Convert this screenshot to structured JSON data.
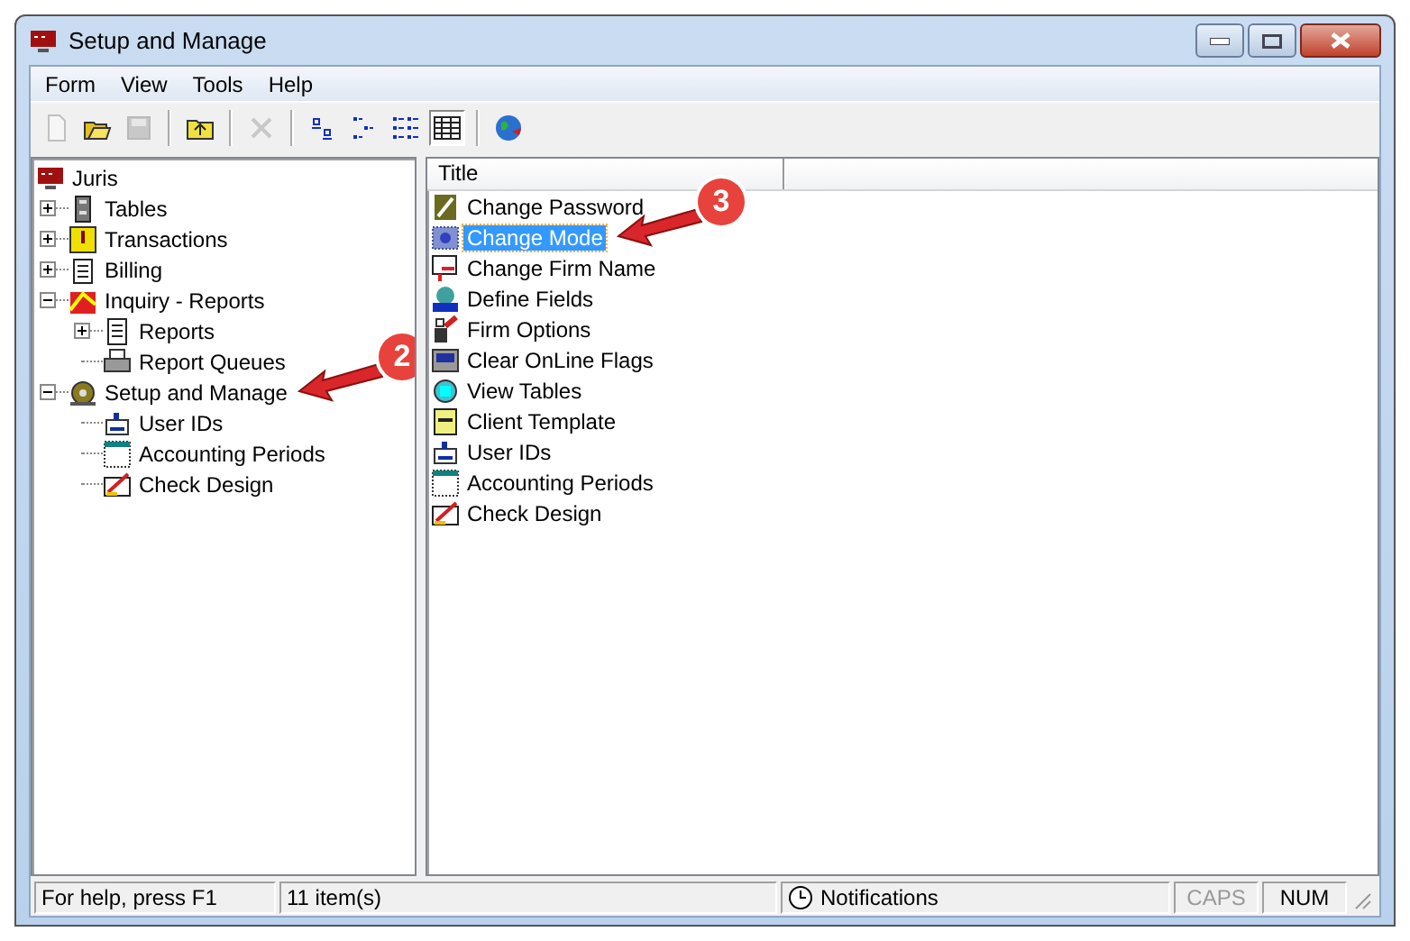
{
  "window": {
    "title": "Setup and Manage"
  },
  "menu": [
    "Form",
    "View",
    "Tools",
    "Help"
  ],
  "toolbar": [
    {
      "kind": "new",
      "disabled": true
    },
    {
      "kind": "open",
      "disabled": false
    },
    {
      "kind": "save",
      "disabled": true
    },
    {
      "kind": "sep"
    },
    {
      "kind": "up",
      "disabled": false
    },
    {
      "kind": "sep"
    },
    {
      "kind": "delete",
      "disabled": true
    },
    {
      "kind": "sep"
    },
    {
      "kind": "large",
      "disabled": false,
      "pressed": false
    },
    {
      "kind": "small",
      "disabled": false,
      "pressed": false
    },
    {
      "kind": "list",
      "disabled": false,
      "pressed": false
    },
    {
      "kind": "details",
      "disabled": false,
      "pressed": true
    },
    {
      "kind": "sep"
    },
    {
      "kind": "globe",
      "disabled": false
    }
  ],
  "tree": {
    "label": "Juris",
    "children": [
      {
        "label": "Tables",
        "expanded": false
      },
      {
        "label": "Transactions",
        "expanded": false
      },
      {
        "label": "Billing",
        "expanded": false
      },
      {
        "label": "Inquiry - Reports",
        "expanded": true,
        "children": [
          {
            "label": "Reports",
            "expanded": false
          },
          {
            "label": "Report Queues"
          }
        ]
      },
      {
        "label": "Setup and Manage",
        "expanded": true,
        "children": [
          {
            "label": "User IDs"
          },
          {
            "label": "Accounting Periods"
          },
          {
            "label": "Check Design"
          }
        ]
      }
    ]
  },
  "list": {
    "columns": [
      "Title"
    ],
    "rows": [
      {
        "title": "Change Password",
        "selected": false
      },
      {
        "title": "Change Mode",
        "selected": true
      },
      {
        "title": "Change Firm Name",
        "selected": false
      },
      {
        "title": "Define Fields",
        "selected": false
      },
      {
        "title": "Firm Options",
        "selected": false
      },
      {
        "title": "Clear OnLine Flags",
        "selected": false
      },
      {
        "title": "View Tables",
        "selected": false
      },
      {
        "title": "Client Template",
        "selected": false
      },
      {
        "title": "User IDs",
        "selected": false
      },
      {
        "title": "Accounting Periods",
        "selected": false
      },
      {
        "title": "Check Design",
        "selected": false
      }
    ]
  },
  "callouts": [
    {
      "label": "2"
    },
    {
      "label": "3"
    }
  ],
  "status_bar": {
    "help": "For help, press F1",
    "count": "11 item(s)",
    "notifications": "Notifications",
    "indicators": [
      {
        "label": "CAPS",
        "on": false
      },
      {
        "label": "NUM",
        "on": true
      }
    ]
  }
}
